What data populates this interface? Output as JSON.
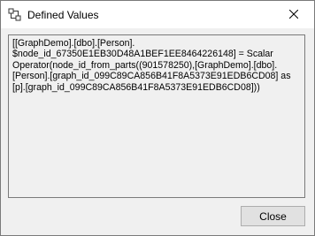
{
  "window": {
    "title": "Defined Values",
    "icon": "defined-values-icon"
  },
  "titlebar_controls": {
    "close_icon": "close-icon"
  },
  "content": {
    "lines": [
      "[[GraphDemo].[dbo].[Person].",
      "$node_id_67350E1EB30D48A1BEF1EE8464226148] = Scalar",
      "Operator(node_id_from_parts((901578250),[GraphDemo].[dbo].",
      "[Person].[graph_id_099C89CA856B41F8A5373E91EDB6CD08] as",
      "[p].[graph_id_099C89CA856B41F8A5373E91EDB6CD08]))"
    ]
  },
  "buttons": {
    "close_label": "Close"
  }
}
